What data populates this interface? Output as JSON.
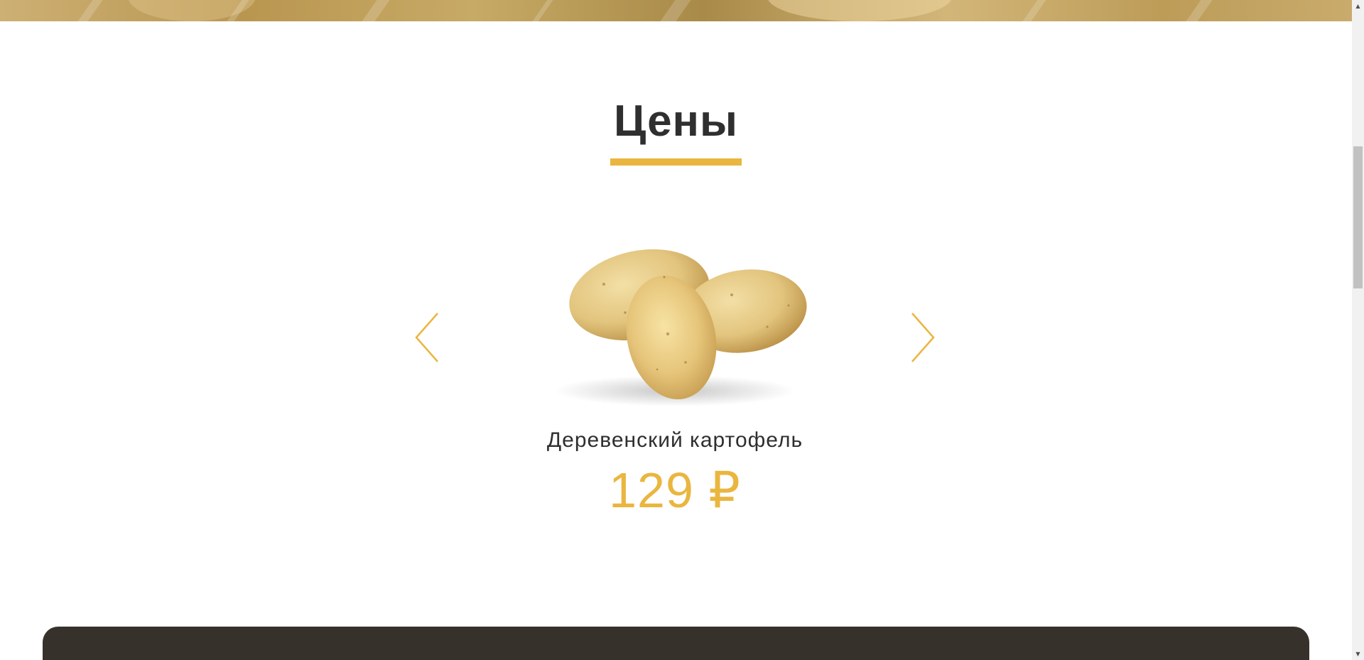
{
  "section": {
    "title": "Цены"
  },
  "slider": {
    "product": {
      "name": "Деревенский картофель",
      "price": "129 ₽",
      "image_icon": "potatoes-image"
    },
    "prev_icon": "chevron-left-icon",
    "next_icon": "chevron-right-icon"
  },
  "colors": {
    "accent": "#eab63f",
    "title_text": "#2f2f2f",
    "dark_panel": "#36322b"
  }
}
